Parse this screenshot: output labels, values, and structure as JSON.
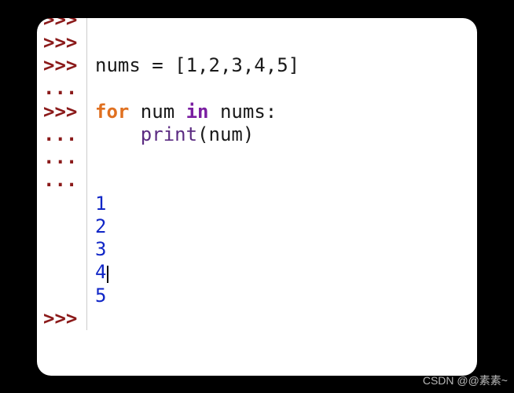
{
  "prompts": {
    "primary": ">>>",
    "continuation": "..."
  },
  "lines": [
    {
      "prompt": "primary",
      "segments": []
    },
    {
      "prompt": "primary",
      "segments": []
    },
    {
      "prompt": "primary",
      "segments": [
        {
          "text": "nums = [1,2,3,4,5]",
          "cls": ""
        }
      ]
    },
    {
      "prompt": "continuation",
      "segments": []
    },
    {
      "prompt": "primary",
      "segments": [
        {
          "text": "for",
          "cls": "kw-for"
        },
        {
          "text": " num ",
          "cls": ""
        },
        {
          "text": "in",
          "cls": "kw-in"
        },
        {
          "text": " nums:",
          "cls": ""
        }
      ]
    },
    {
      "prompt": "continuation",
      "segments": [
        {
          "text": "    ",
          "cls": ""
        },
        {
          "text": "print",
          "cls": "fn-print"
        },
        {
          "text": "(num)",
          "cls": ""
        }
      ]
    },
    {
      "prompt": "continuation",
      "segments": []
    },
    {
      "prompt": "continuation",
      "segments": []
    },
    {
      "prompt": "",
      "segments": []
    },
    {
      "prompt": "",
      "segments": [
        {
          "text": "1",
          "cls": "output"
        }
      ]
    },
    {
      "prompt": "",
      "segments": [
        {
          "text": "2",
          "cls": "output"
        }
      ]
    },
    {
      "prompt": "",
      "segments": [
        {
          "text": "3",
          "cls": "output"
        }
      ]
    },
    {
      "prompt": "",
      "segments": [
        {
          "text": "4",
          "cls": "output",
          "cursor": true
        }
      ]
    },
    {
      "prompt": "",
      "segments": [
        {
          "text": "5",
          "cls": "output"
        }
      ]
    },
    {
      "prompt": "primary",
      "segments": []
    }
  ],
  "watermark": "CSDN @@素素~"
}
